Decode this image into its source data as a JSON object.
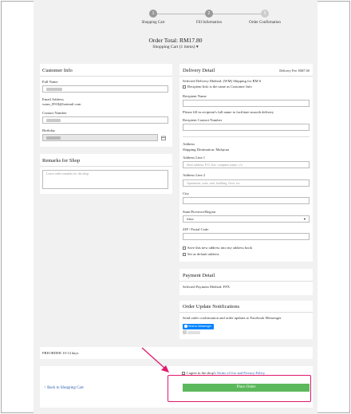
{
  "steps": [
    {
      "num": "1",
      "label": "Shopping Cart"
    },
    {
      "num": "2",
      "label": "Fill Information"
    },
    {
      "num": "3",
      "label": "Order Confirmation"
    }
  ],
  "order": {
    "total": "Order Total: RM17.80",
    "cart_summary": "Shopping Cart (1 items)",
    "chevron": "▾"
  },
  "customer": {
    "title": "Customer Info",
    "full_name_label": "Full Name",
    "email_label": "Email Address",
    "email_value": "waan_0918@hotmail.com",
    "contact_label": "Contact Number",
    "birthday_label": "Birthday"
  },
  "remarks": {
    "title": "Remarks for Shop",
    "placeholder": "Leave order remarks for the shop"
  },
  "delivery": {
    "title": "Delivery Detail",
    "fee": "Delivery Fee: RM7.00",
    "method": "Selected Delivery Method:  (WM)  Shipping for RM 6",
    "same_as_customer": "Recipient Info is the same as Customer Info",
    "recipient_name_label": "Recipient Name",
    "recipient_hint": "Please fill in recipient's full name to facilitate smooth delivery",
    "recipient_contact_label": "Recipient Contact Number",
    "address_label": "Address",
    "destination": "Shipping Destination: Malaysia",
    "line1_label": "Address Line 1",
    "line1_placeholder": "Steet address, P.O. box, company name, c/o",
    "line2_label": "Address Line 2",
    "line2_placeholder": "Apartment, suite, unit, building, floor, etc.",
    "city_label": "City",
    "state_label": "State/Province/Region",
    "state_value": "Johor",
    "zip_label": "ZIP / Postal Code",
    "save_address": "Save this new address into my address book",
    "set_default": "Set as default address"
  },
  "payment": {
    "title": "Payment Detail",
    "method": "Selected Payment Method: FPX"
  },
  "notifications": {
    "title": "Order Update Notifications",
    "desc": "Send order confirmation and order updates to Facebook Messenger",
    "button": "Send to Messenger"
  },
  "preorder": {
    "text": "PREORDER 10-14 days"
  },
  "footer": {
    "agree_prefix": "I agree to the shop's ",
    "terms_link": "Terms of Use and Privacy Policy",
    "back_link": "< Back to Shopping Cart",
    "place_order": "Place Order"
  },
  "colors": {
    "place_order": "#5cb85c",
    "highlight": "#e0196b",
    "messenger": "#0084ff"
  }
}
